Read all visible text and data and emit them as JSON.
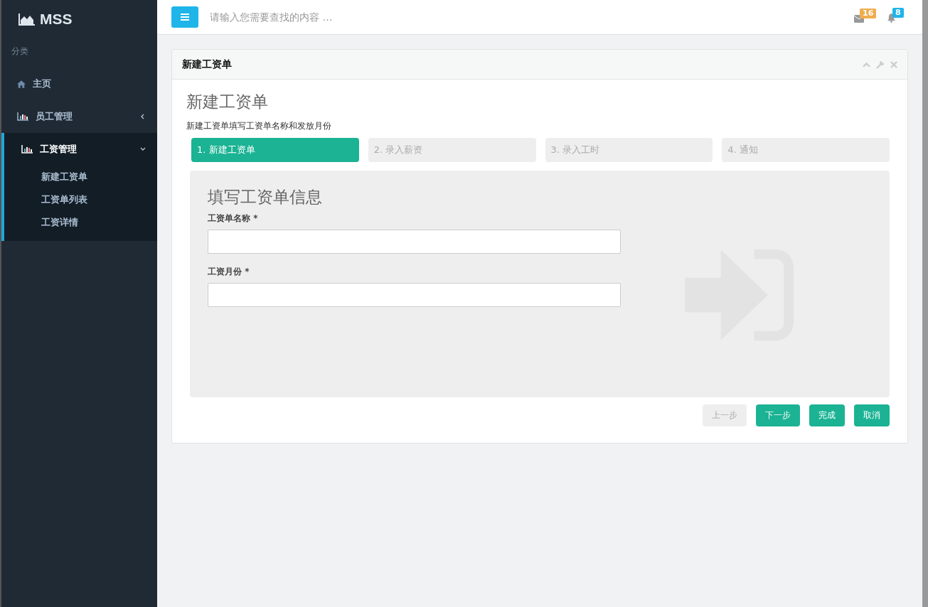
{
  "brand": {
    "name": "MSS"
  },
  "sidebar": {
    "section": "分类",
    "items": [
      {
        "label": "主页",
        "kind": "link",
        "selected": false
      },
      {
        "label": "员工管理",
        "kind": "menu",
        "expanded": false,
        "selected": false
      },
      {
        "label": "工资管理",
        "kind": "menu",
        "expanded": true,
        "selected": true,
        "children": [
          {
            "label": "新建工资单"
          },
          {
            "label": "工资单列表"
          },
          {
            "label": "工资详情"
          }
        ]
      }
    ]
  },
  "topbar": {
    "search": {
      "placeholder": "请输入您需要查找的内容 …"
    },
    "mail_count": "16",
    "notification_count": "8"
  },
  "panel": {
    "title": "新建工资单",
    "heading": "新建工资单",
    "description": "新建工资单填写工资单名称和发放月份",
    "steps": [
      {
        "label": "1. 新建工资单",
        "selected": true
      },
      {
        "label": "2. 录入薪资",
        "selected": false
      },
      {
        "label": "3. 录入工时",
        "selected": false
      },
      {
        "label": "4. 通知",
        "selected": false
      }
    ],
    "form": {
      "title": "填写工资单信息",
      "fields": [
        {
          "label": "工资单名称 *"
        },
        {
          "label": "工资月份 *"
        }
      ]
    },
    "buttons": [
      {
        "label": "上一步",
        "disabled": true
      },
      {
        "label": "下一步",
        "disabled": false
      },
      {
        "label": "完成",
        "disabled": false
      },
      {
        "label": "取消",
        "disabled": false
      }
    ]
  }
}
